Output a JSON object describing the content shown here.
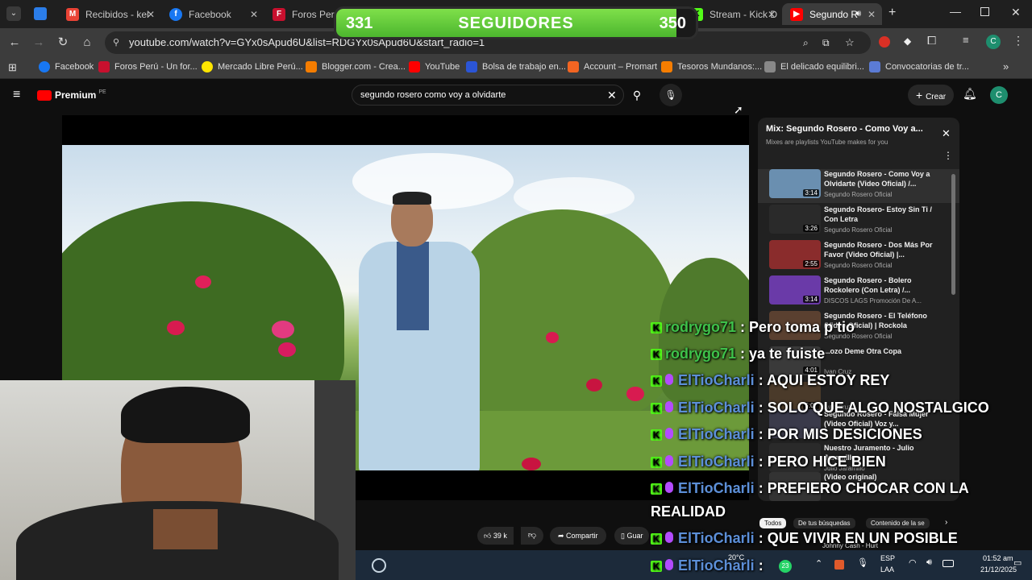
{
  "tabs": [
    {
      "label": "Recibidos - kel",
      "color": "#ea4335",
      "icon": "gmail-icon"
    },
    {
      "label": "Facebook",
      "color": "#1877f2",
      "icon": "facebook-icon"
    },
    {
      "label": "Foros Perú Cl",
      "color": "#c8102e",
      "icon": "foros-icon"
    },
    {
      "label": "Stream - Kick D",
      "color": "#53fc18",
      "icon": "kick-icon"
    },
    {
      "label": "Segundo R",
      "color": "#ff0000",
      "icon": "youtube-icon"
    }
  ],
  "address": {
    "url": "youtube.com/watch?v=GYx0sApud6U&list=RDGYx0sApud6U&start_radio=1"
  },
  "bookmarks": [
    {
      "label": "Facebook",
      "color": "#1877f2"
    },
    {
      "label": "Foros Perú - Un for...",
      "color": "#c8102e"
    },
    {
      "label": "Mercado Libre Perú...",
      "color": "#ffe600"
    },
    {
      "label": "Blogger.com - Crea...",
      "color": "#f57d00"
    },
    {
      "label": "YouTube",
      "color": "#ff0000"
    },
    {
      "label": "Bolsa de trabajo en...",
      "color": "#2b55d6"
    },
    {
      "label": "Account – Promart",
      "color": "#f26522"
    },
    {
      "label": "Tesoros Mundanos:...",
      "color": "#f57d00"
    },
    {
      "label": "El delicado equilibri...",
      "color": "#888888"
    },
    {
      "label": "Convocatorias de tr...",
      "color": "#5b7bd5"
    }
  ],
  "youtube": {
    "logo": "Premium",
    "region": "PE",
    "search_value": "segundo rosero como voy a olvidarte",
    "create_label": "Crear",
    "avatar_letter": "C"
  },
  "actions": {
    "likes": "39 k",
    "share": "Compartir",
    "save": "Guar"
  },
  "playlist": {
    "title": "Mix: Segundo Rosero - Como Voy a...",
    "subtitle": "Mixes are playlists YouTube makes for you",
    "items": [
      {
        "title": "Segundo Rosero - Como Voy a Olvidarte (Video Oficial) /...",
        "channel": "Segundo Rosero Oficial",
        "duration": "3:14",
        "thumb": "#6a8fb0"
      },
      {
        "title": "Segundo Rosero- Estoy Sin Ti / Con Letra",
        "channel": "Segundo Rosero Oficial",
        "duration": "3:26",
        "thumb": "#2a2a2a"
      },
      {
        "title": "Segundo Rosero - Dos Más Por Favor (Video Oficial) |...",
        "channel": "Segundo Rosero Oficial",
        "duration": "2:55",
        "thumb": "#8a2c2c"
      },
      {
        "title": "Segundo Rosero - Bolero Rockolero (Con Letra) /...",
        "channel": "DISCOS LAGS Promoción De A...",
        "duration": "3:14",
        "thumb": "#6a3aa8"
      },
      {
        "title": "Segundo Rosero - El Teléfono (Video Oficial) | Rockola",
        "channel": "Segundo Rosero Oficial",
        "duration": "",
        "thumb": "#5a4030"
      },
      {
        "title": "...ozo Deme Otra Copa",
        "channel": "Ivan Cruz",
        "duration": "4:01",
        "thumb": "#3a3a3a"
      },
      {
        "title": "",
        "channel": "Ivan Cruz",
        "duration": "5:07",
        "thumb": "#4a3a2a"
      },
      {
        "title": "Segundo Rosero - Falsa Mujer (Video Oficial) Voz y...",
        "channel": "",
        "duration": "",
        "thumb": "#3a3a4a"
      },
      {
        "title": "Nuestro Juramento - Julio Jaramillo",
        "channel": "Julio Jaramillo",
        "duration": "",
        "thumb": "#2a2a2a"
      },
      {
        "title": "(Video original)",
        "channel": "",
        "duration": "",
        "thumb": "#333333"
      }
    ],
    "chips": [
      "Todos",
      "De tus búsquedas",
      "Contenido de la se"
    ],
    "bottom_item": "Johnny Cash - Hurt"
  },
  "banner": {
    "current": "331",
    "label": "SEGUIDORES",
    "goal": "350",
    "progress": 0.946
  },
  "chat": [
    {
      "user": "rodrygo71",
      "msg": ": Pero toma p tio",
      "style": "green"
    },
    {
      "user": "rodrygo71",
      "msg": ": ya te fuiste",
      "style": "green"
    },
    {
      "user": "ElTioCharli",
      "msg": ": AQUI ESTOY REY",
      "style": "blue"
    },
    {
      "user": "ElTioCharli",
      "msg": ": SOLO QUE ALGO NOSTALGICO",
      "style": "blue"
    },
    {
      "user": "ElTioCharli",
      "msg": ": POR MIS DESICIONES",
      "style": "blue"
    },
    {
      "user": "ElTioCharli",
      "msg": ": PERO HICE BIEN",
      "style": "blue"
    },
    {
      "user": "ElTioCharli",
      "msg": ": PREFIERO CHOCAR CON LA",
      "style": "blue"
    },
    {
      "user": "",
      "msg": "REALIDAD",
      "style": "cont"
    },
    {
      "user": "ElTioCharli",
      "msg": ": QUE VIVIR EN UN POSIBLE",
      "style": "blue"
    },
    {
      "user": "ElTioCharli",
      "msg": ":",
      "style": "blue"
    }
  ],
  "taskbar": {
    "weather": "20°C",
    "lang1": "ESP",
    "lang2": "LAA",
    "time": "01:52 am",
    "date": "21/12/2025"
  }
}
